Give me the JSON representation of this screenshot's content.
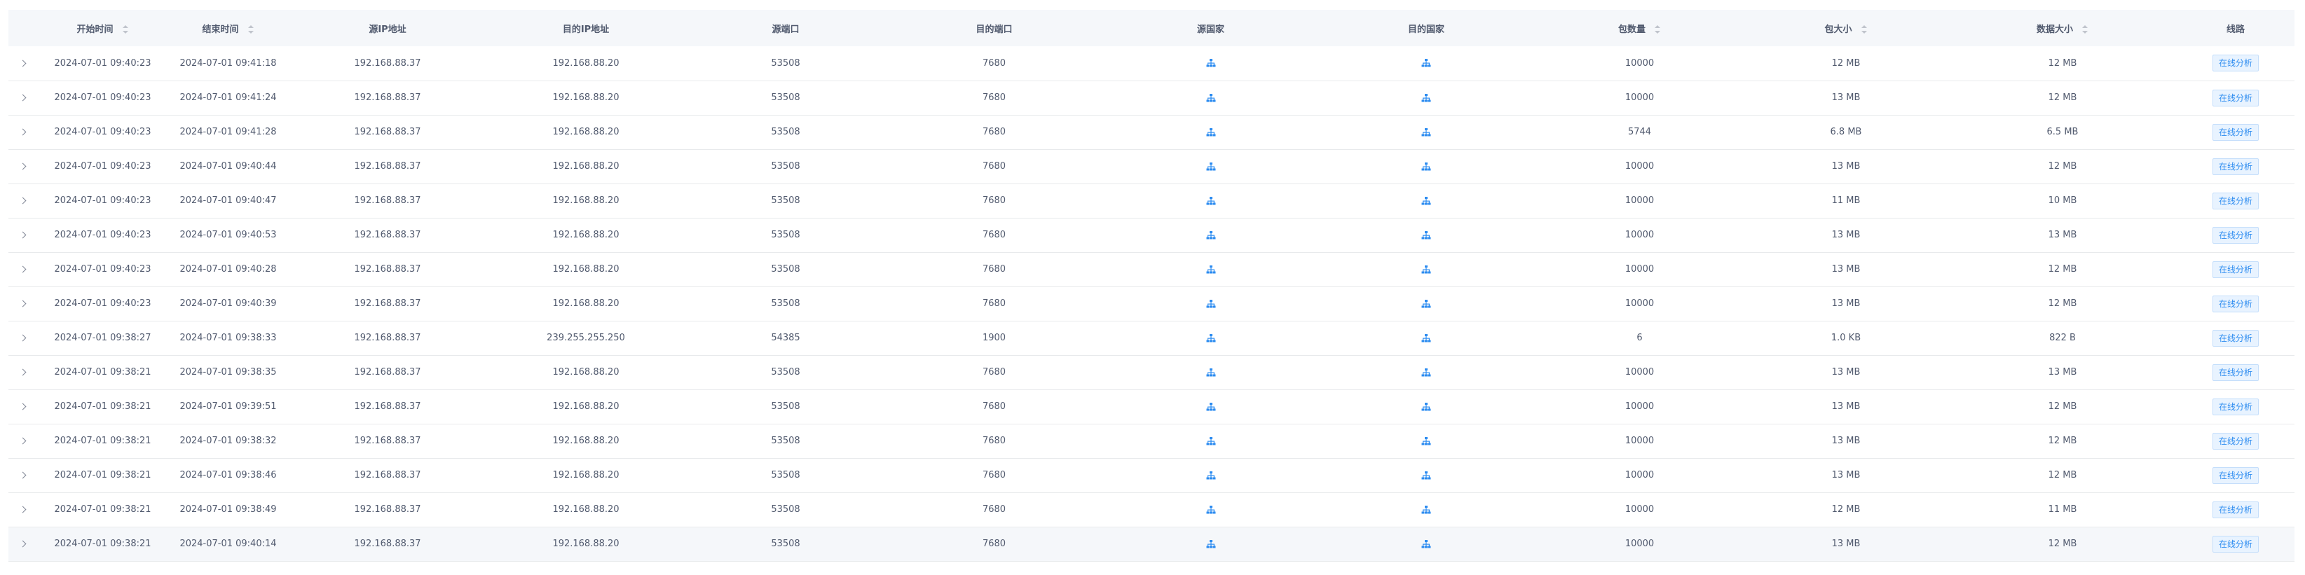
{
  "columns": {
    "start_time": "开始时间",
    "end_time": "结束时间",
    "src_ip": "源IP地址",
    "dst_ip": "目的IP地址",
    "src_port": "源端口",
    "dst_port": "目的端口",
    "src_country": "源国家",
    "dst_country": "目的国家",
    "packet_count": "包数量",
    "packet_size": "包大小",
    "data_size": "数据大小",
    "path": "线路"
  },
  "action_label": "在线分析",
  "colors": {
    "accent": "#2d8cf0",
    "header_bg": "#f5f7fa",
    "border": "#e8eaec"
  },
  "icons": {
    "country": "network-icon",
    "expand": "chevron-right-icon"
  },
  "rows": [
    {
      "start": "2024-07-01 09:40:23",
      "end": "2024-07-01 09:41:18",
      "src_ip": "192.168.88.37",
      "dst_ip": "192.168.88.20",
      "src_port": "53508",
      "dst_port": "7680",
      "packets": "10000",
      "psize": "12 MB",
      "dsize": "12 MB"
    },
    {
      "start": "2024-07-01 09:40:23",
      "end": "2024-07-01 09:41:24",
      "src_ip": "192.168.88.37",
      "dst_ip": "192.168.88.20",
      "src_port": "53508",
      "dst_port": "7680",
      "packets": "10000",
      "psize": "13 MB",
      "dsize": "12 MB"
    },
    {
      "start": "2024-07-01 09:40:23",
      "end": "2024-07-01 09:41:28",
      "src_ip": "192.168.88.37",
      "dst_ip": "192.168.88.20",
      "src_port": "53508",
      "dst_port": "7680",
      "packets": "5744",
      "psize": "6.8 MB",
      "dsize": "6.5 MB"
    },
    {
      "start": "2024-07-01 09:40:23",
      "end": "2024-07-01 09:40:44",
      "src_ip": "192.168.88.37",
      "dst_ip": "192.168.88.20",
      "src_port": "53508",
      "dst_port": "7680",
      "packets": "10000",
      "psize": "13 MB",
      "dsize": "12 MB"
    },
    {
      "start": "2024-07-01 09:40:23",
      "end": "2024-07-01 09:40:47",
      "src_ip": "192.168.88.37",
      "dst_ip": "192.168.88.20",
      "src_port": "53508",
      "dst_port": "7680",
      "packets": "10000",
      "psize": "11 MB",
      "dsize": "10 MB"
    },
    {
      "start": "2024-07-01 09:40:23",
      "end": "2024-07-01 09:40:53",
      "src_ip": "192.168.88.37",
      "dst_ip": "192.168.88.20",
      "src_port": "53508",
      "dst_port": "7680",
      "packets": "10000",
      "psize": "13 MB",
      "dsize": "13 MB"
    },
    {
      "start": "2024-07-01 09:40:23",
      "end": "2024-07-01 09:40:28",
      "src_ip": "192.168.88.37",
      "dst_ip": "192.168.88.20",
      "src_port": "53508",
      "dst_port": "7680",
      "packets": "10000",
      "psize": "13 MB",
      "dsize": "12 MB"
    },
    {
      "start": "2024-07-01 09:40:23",
      "end": "2024-07-01 09:40:39",
      "src_ip": "192.168.88.37",
      "dst_ip": "192.168.88.20",
      "src_port": "53508",
      "dst_port": "7680",
      "packets": "10000",
      "psize": "13 MB",
      "dsize": "12 MB"
    },
    {
      "start": "2024-07-01 09:38:27",
      "end": "2024-07-01 09:38:33",
      "src_ip": "192.168.88.37",
      "dst_ip": "239.255.255.250",
      "src_port": "54385",
      "dst_port": "1900",
      "packets": "6",
      "psize": "1.0 KB",
      "dsize": "822 B"
    },
    {
      "start": "2024-07-01 09:38:21",
      "end": "2024-07-01 09:38:35",
      "src_ip": "192.168.88.37",
      "dst_ip": "192.168.88.20",
      "src_port": "53508",
      "dst_port": "7680",
      "packets": "10000",
      "psize": "13 MB",
      "dsize": "13 MB"
    },
    {
      "start": "2024-07-01 09:38:21",
      "end": "2024-07-01 09:39:51",
      "src_ip": "192.168.88.37",
      "dst_ip": "192.168.88.20",
      "src_port": "53508",
      "dst_port": "7680",
      "packets": "10000",
      "psize": "13 MB",
      "dsize": "12 MB"
    },
    {
      "start": "2024-07-01 09:38:21",
      "end": "2024-07-01 09:38:32",
      "src_ip": "192.168.88.37",
      "dst_ip": "192.168.88.20",
      "src_port": "53508",
      "dst_port": "7680",
      "packets": "10000",
      "psize": "13 MB",
      "dsize": "12 MB"
    },
    {
      "start": "2024-07-01 09:38:21",
      "end": "2024-07-01 09:38:46",
      "src_ip": "192.168.88.37",
      "dst_ip": "192.168.88.20",
      "src_port": "53508",
      "dst_port": "7680",
      "packets": "10000",
      "psize": "13 MB",
      "dsize": "12 MB"
    },
    {
      "start": "2024-07-01 09:38:21",
      "end": "2024-07-01 09:38:49",
      "src_ip": "192.168.88.37",
      "dst_ip": "192.168.88.20",
      "src_port": "53508",
      "dst_port": "7680",
      "packets": "10000",
      "psize": "12 MB",
      "dsize": "11 MB"
    },
    {
      "start": "2024-07-01 09:38:21",
      "end": "2024-07-01 09:40:14",
      "src_ip": "192.168.88.37",
      "dst_ip": "192.168.88.20",
      "src_port": "53508",
      "dst_port": "7680",
      "packets": "10000",
      "psize": "13 MB",
      "dsize": "12 MB"
    }
  ]
}
